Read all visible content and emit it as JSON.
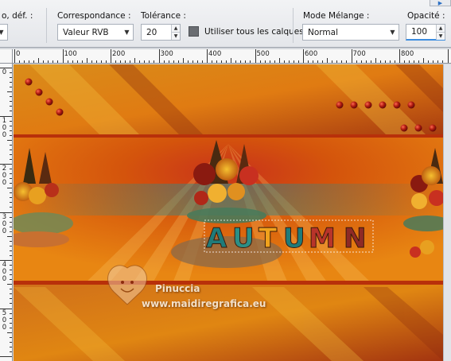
{
  "toolbar": {
    "correspondance": {
      "label": "Correspondance :",
      "value": "Valeur RVB"
    },
    "tolerance": {
      "label": "Tolérance :",
      "value": "20"
    },
    "use_all_layers": {
      "label": "Utiliser tous les calques",
      "checked": false
    },
    "blend_mode": {
      "label": "Mode Mélange :",
      "value": "Normal"
    },
    "opacity": {
      "label": "Opacité :",
      "value": "100"
    },
    "cut_label": "o, déf. :"
  },
  "ruler": {
    "h_labels": [
      "0",
      "100",
      "200",
      "300",
      "400",
      "500",
      "600",
      "700",
      "800"
    ],
    "v_labels": [
      [
        "0"
      ],
      [
        "1",
        "0",
        "0"
      ],
      [
        "2",
        "0",
        "0"
      ],
      [
        "3",
        "0",
        "0"
      ],
      [
        "4",
        "0",
        "0"
      ],
      [
        "5",
        "0",
        "0"
      ]
    ]
  },
  "artwork": {
    "title_letters": [
      "A",
      "U",
      "T",
      "U",
      "M",
      "N"
    ],
    "letter_colors": [
      "#1f7b7a",
      "#2b8f86",
      "#f0a21c",
      "#1f7b7a",
      "#b8342a",
      "#8e2a26"
    ],
    "watermark_name": "Pinuccia",
    "watermark_url": "www.maidiregrafica.eu",
    "palette": {
      "orange": "#e27a10",
      "deep_orange": "#c44a0a",
      "gold": "#e8a630",
      "teal": "#2e8a88",
      "dark_red": "#8a1e12"
    }
  }
}
